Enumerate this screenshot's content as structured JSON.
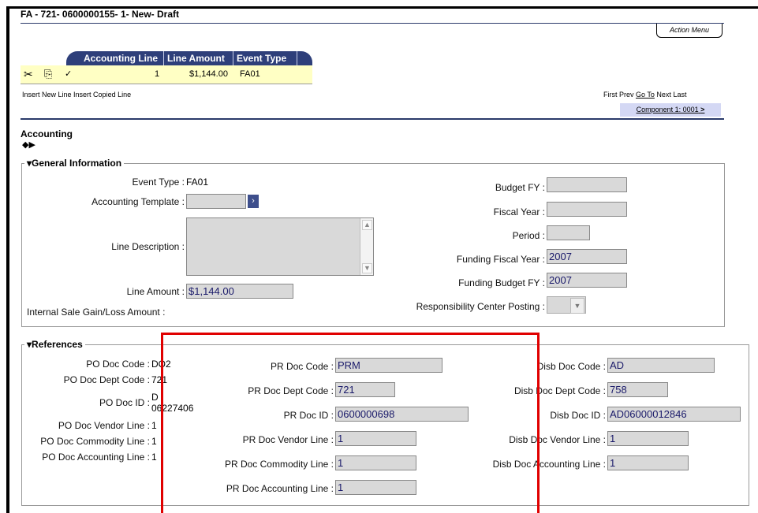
{
  "header": {
    "title": "FA - 721- 0600000155- 1- New- Draft",
    "action_menu": "Action Menu"
  },
  "grid": {
    "columns": [
      "Accounting Line",
      "Line Amount",
      "Event Type"
    ],
    "row": {
      "accounting_line": "1",
      "line_amount": "$1,144.00",
      "event_type": "FA01"
    },
    "icons": [
      "scissors-icon",
      "copy-icon",
      "check-icon"
    ],
    "insert_new": "Insert New Line",
    "insert_copied": "Insert Copied Line"
  },
  "nav": {
    "first": "First",
    "prev": "Prev",
    "goto": "Go To",
    "next": "Next",
    "last": "Last",
    "component": "Component 1: 0001",
    "component_arrow": ">"
  },
  "accounting": {
    "title": "Accounting"
  },
  "general": {
    "legend": "General Information",
    "event_type_label": "Event Type :",
    "event_type_value": "FA01",
    "accounting_template_label": "Accounting Template :",
    "line_description_label": "Line Description :",
    "line_amount_label": "Line Amount :",
    "line_amount_value": "$1,144.00",
    "internal_sale_label": "Internal Sale Gain/Loss Amount :",
    "budget_fy_label": "Budget FY :",
    "fiscal_year_label": "Fiscal Year :",
    "period_label": "Period :",
    "funding_fiscal_year_label": "Funding Fiscal Year :",
    "funding_fiscal_year_value": "2007",
    "funding_budget_fy_label": "Funding Budget FY :",
    "funding_budget_fy_value": "2007",
    "responsibility_label": "Responsibility Center Posting :"
  },
  "references": {
    "legend": "References",
    "po_doc_code_label": "PO Doc Code :",
    "po_doc_code_value": "DO2",
    "po_doc_dept_label": "PO Doc Dept Code :",
    "po_doc_dept_value": "721",
    "po_doc_id_label": "PO Doc ID :",
    "po_doc_id_value_1": "D",
    "po_doc_id_value_2": "06227406",
    "po_vendor_label": "PO Doc Vendor Line :",
    "po_vendor_value": "1",
    "po_commodity_label": "PO Doc Commodity Line :",
    "po_commodity_value": "1",
    "po_accounting_label": "PO Doc Accounting Line :",
    "po_accounting_value": "1",
    "pr_doc_code_label": "PR Doc Code :",
    "pr_doc_code_value": "PRM",
    "pr_doc_dept_label": "PR Doc Dept Code :",
    "pr_doc_dept_value": "721",
    "pr_doc_id_label": "PR Doc ID :",
    "pr_doc_id_value": "0600000698",
    "pr_vendor_label": "PR Doc Vendor Line :",
    "pr_vendor_value": "1",
    "pr_commodity_label": "PR Doc Commodity Line :",
    "pr_commodity_value": "1",
    "pr_accounting_label": "PR Doc Accounting Line :",
    "pr_accounting_value": "1",
    "disb_doc_code_label": "Disb Doc Code :",
    "disb_doc_code_value": "AD",
    "disb_doc_dept_label": "Disb Doc Dept Code :",
    "disb_doc_dept_value": "758",
    "disb_doc_id_label": "Disb Doc ID :",
    "disb_doc_id_value": "AD06000012846",
    "disb_vendor_label": "Disb Doc Vendor Line :",
    "disb_vendor_value": "1",
    "disb_accounting_label": "Disb Doc Accounting Line :",
    "disb_accounting_value": "1"
  },
  "colors": {
    "header_blue": "#2e3f7a",
    "row_yellow": "#ffffc4",
    "highlight_red": "#e00000",
    "field_gray": "#d9d9d9"
  }
}
